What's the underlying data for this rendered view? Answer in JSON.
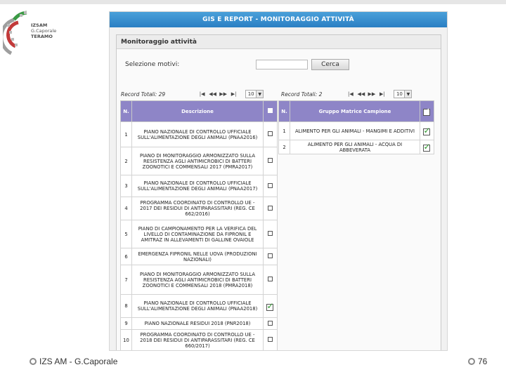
{
  "slide": {
    "footer_left": "IZS AM  -  G.Caporale",
    "page_number": "76",
    "logo": {
      "line1": "IZSAM",
      "line2": "G.Caporale",
      "line3": "TERAMO"
    }
  },
  "app": {
    "title": "GIS E REPORT - MONITORAGGIO ATTIVITÀ",
    "section_title": "Monitoraggio attività",
    "filter_label": "Selezione motivi:",
    "search_button": "Cerca",
    "filter_value": ""
  },
  "left_table": {
    "record_total": "Record Totali: 29",
    "page_size": "10",
    "headers": {
      "num": "N.",
      "desc": "Descrizione"
    },
    "rows": [
      {
        "n": "1",
        "desc": "PIANO NAZIONALE DI CONTROLLO UFFICIALE SULL'ALIMENTAZIONE DEGLI ANIMALI (PNAA2016)",
        "checked": false
      },
      {
        "n": "2",
        "desc": "PIANO DI MONITORAGGIO ARMONIZZATO SULLA RESISTENZA AGLI ANTIMICROBICI DI BATTERI ZOONOTICI E COMMENSALI 2017 (PMRA2017)",
        "checked": false
      },
      {
        "n": "3",
        "desc": "PIANO NAZIONALE DI CONTROLLO UFFICIALE SULL'ALIMENTAZIONE DEGLI ANIMALI (PNAA2017)",
        "checked": false
      },
      {
        "n": "4",
        "desc": "PROGRAMMA COORDINATO DI CONTROLLO UE - 2017 DEI RESIDUI DI ANTIPARASSITARI (REG. CE 662/2016)",
        "checked": false
      },
      {
        "n": "5",
        "desc": "PIANO DI CAMPIONAMENTO PER LA VERIFICA DEL LIVELLO DI CONTAMINAZIONE DA FIPRONIL E AMITRAZ IN ALLEVAMENTI DI GALLINE OVAIOLE",
        "checked": false
      },
      {
        "n": "6",
        "desc": "EMERGENZA FIPRONIL NELLE UOVA (PRODUZIONI NAZIONALI)",
        "checked": false
      },
      {
        "n": "7",
        "desc": "PIANO DI MONITORAGGIO ARMONIZZATO SULLA RESISTENZA AGLI ANTIMICROBICI DI BATTERI ZOONOTICI E COMMENSALI 2018 (PMRA2018)",
        "checked": false
      },
      {
        "n": "8",
        "desc": "PIANO NAZIONALE DI CONTROLLO UFFICIALE SULL'ALIMENTAZIONE DEGLI ANIMALI (PNAA2018)",
        "checked": true
      },
      {
        "n": "9",
        "desc": "PIANO NAZIONALE RESIDUI 2018 (PNR2018)",
        "checked": false
      },
      {
        "n": "10",
        "desc": "PROGRAMMA COORDINATO DI CONTROLLO UE - 2018 DEI RESIDUI DI ANTIPARASSITARI (REG. CE 660/2017)",
        "checked": false
      }
    ]
  },
  "right_table": {
    "record_total": "Record Totali: 2",
    "page_size": "10",
    "headers": {
      "num": "N.",
      "desc": "Gruppo Matrice Campione"
    },
    "rows": [
      {
        "n": "1",
        "desc": "ALIMENTO PER GLI ANIMALI - MANGIMI E ADDITIVI",
        "checked": true
      },
      {
        "n": "2",
        "desc": "ALIMENTO PER GLI ANIMALI - ACQUA DI ABBEVERATA",
        "checked": true
      }
    ]
  },
  "colors": {
    "titlebar": "#2a7fc3",
    "table_header": "#8e85c7",
    "check_green": "#2f9a2f"
  }
}
